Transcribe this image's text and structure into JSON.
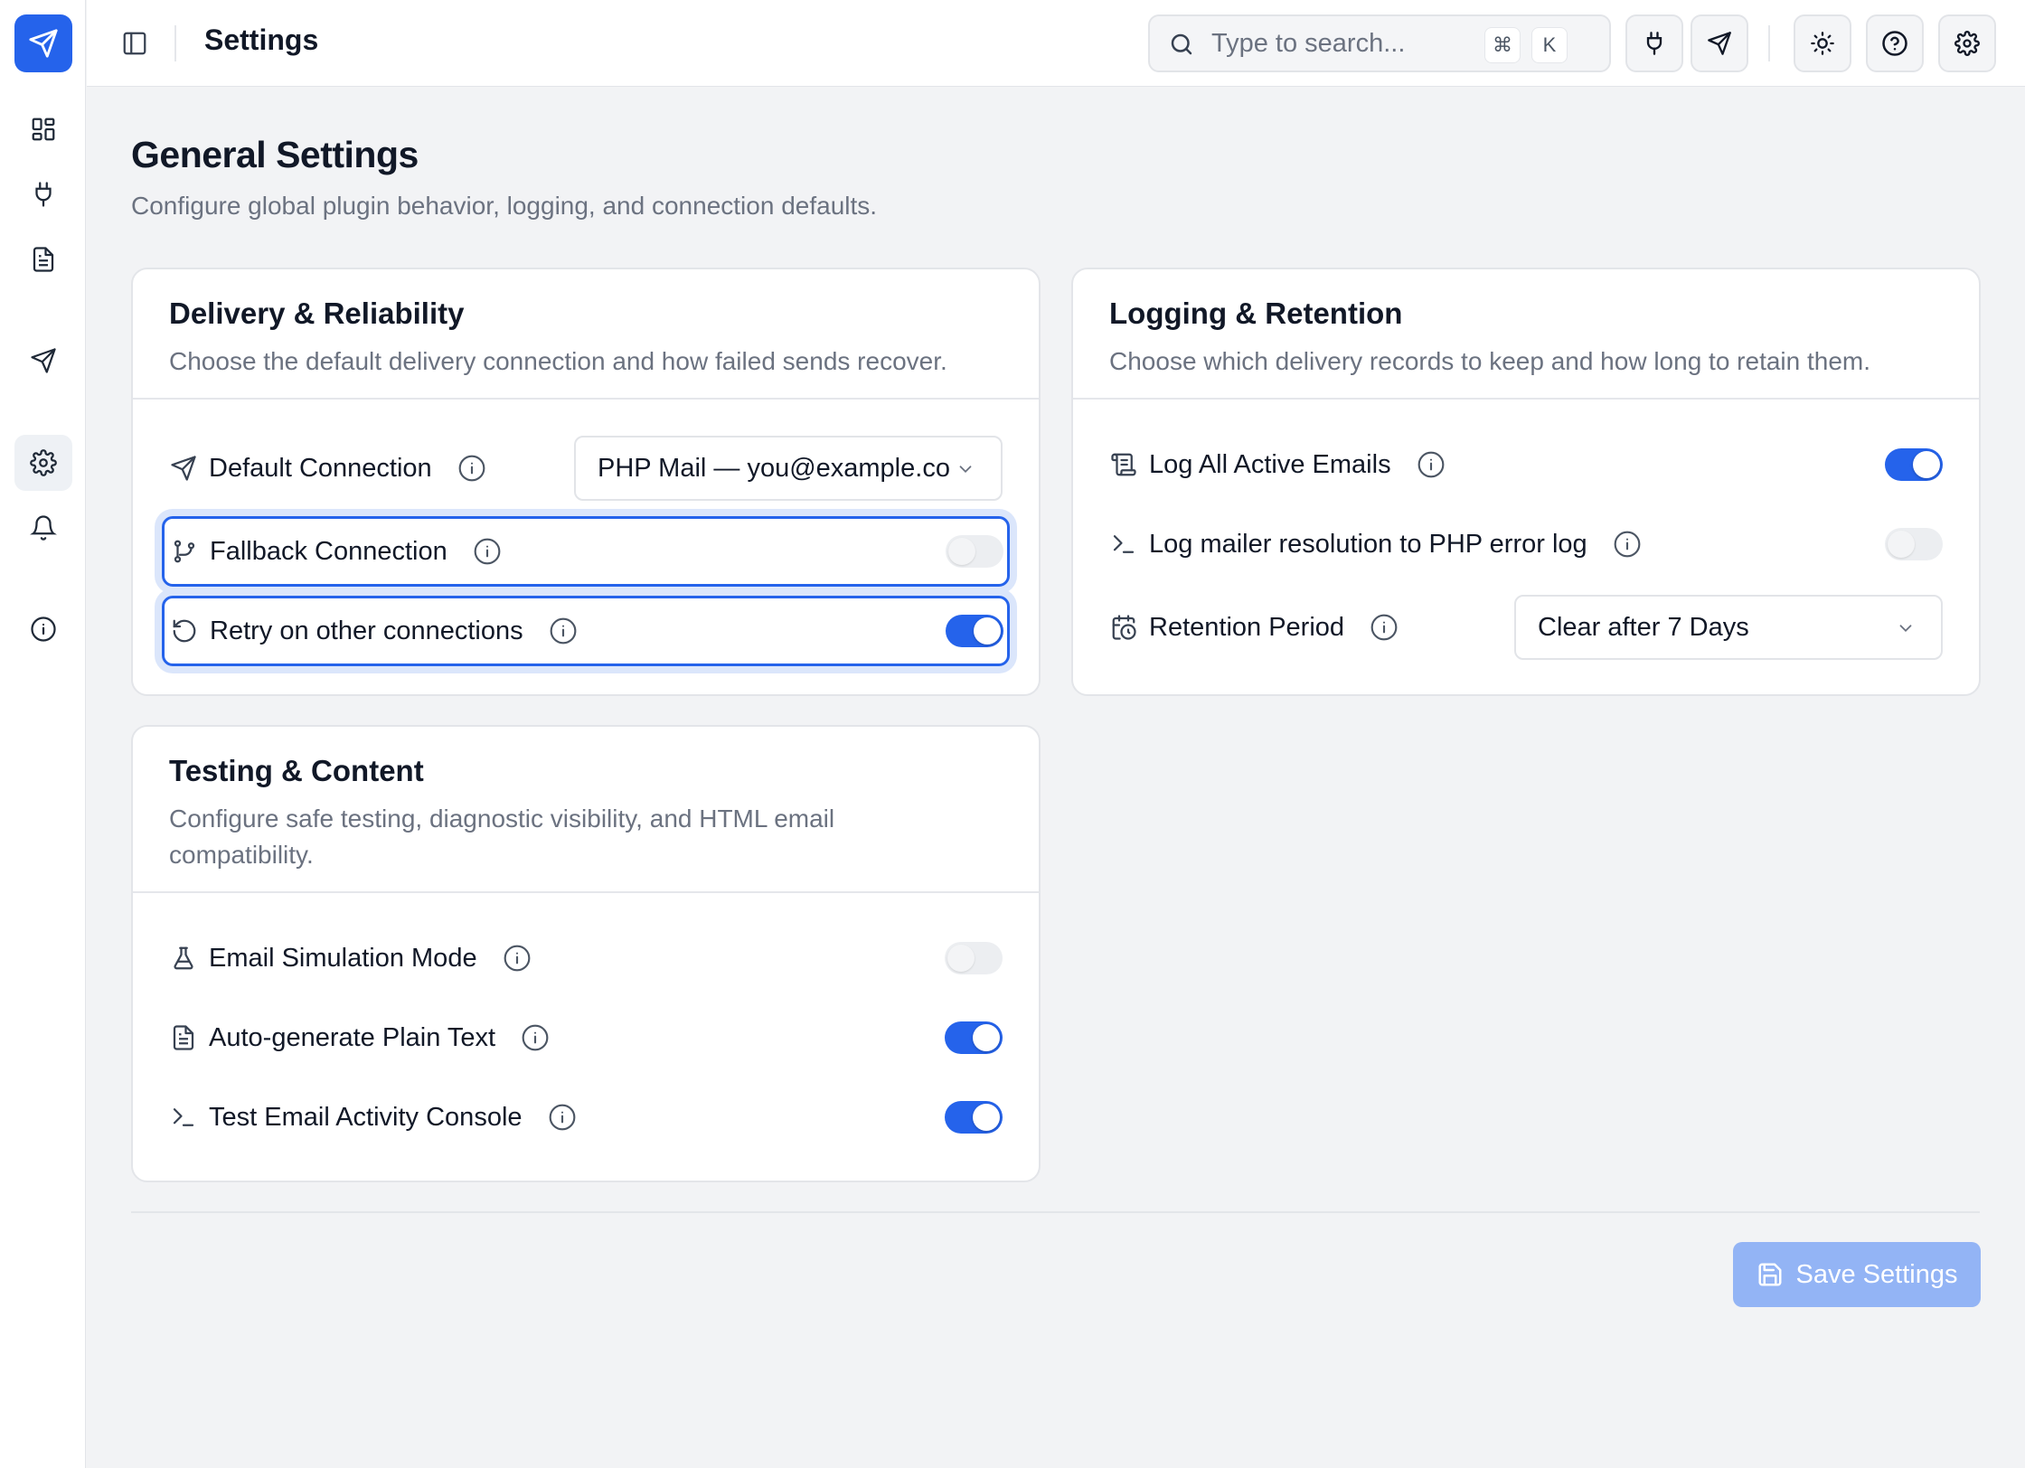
{
  "colors": {
    "accent": "#2563eb",
    "save_disabled": "#93b4f5"
  },
  "sidebar": {
    "items": [
      {
        "name": "dashboard",
        "icon": "dashboard-icon"
      },
      {
        "name": "connections",
        "icon": "plug-icon"
      },
      {
        "name": "logs",
        "icon": "document-icon"
      },
      {
        "name": "send",
        "icon": "send-icon"
      },
      {
        "name": "settings",
        "icon": "gear-icon",
        "active": true
      },
      {
        "name": "notifications",
        "icon": "bell-icon"
      },
      {
        "name": "about",
        "icon": "info-icon"
      }
    ]
  },
  "topbar": {
    "title": "Settings",
    "search": {
      "placeholder": "Type to search...",
      "shortcut_mod": "⌘",
      "shortcut_key": "K"
    }
  },
  "page": {
    "title": "General Settings",
    "subtitle": "Configure global plugin behavior, logging, and connection defaults."
  },
  "delivery": {
    "title": "Delivery & Reliability",
    "description": "Choose the default delivery connection and how failed sends recover.",
    "default_connection": {
      "label": "Default Connection",
      "value": "PHP Mail — you@example.co"
    },
    "fallback_connection": {
      "label": "Fallback Connection",
      "enabled": false
    },
    "retry_connections": {
      "label": "Retry on other connections",
      "enabled": true
    }
  },
  "logging": {
    "title": "Logging & Retention",
    "description": "Choose which delivery records to keep and how long to retain them.",
    "log_all": {
      "label": "Log All Active Emails",
      "enabled": true
    },
    "log_php": {
      "label": "Log mailer resolution to PHP error log",
      "enabled": false
    },
    "retention": {
      "label": "Retention Period",
      "value": "Clear after 7 Days"
    }
  },
  "testing": {
    "title": "Testing & Content",
    "description": "Configure safe testing, diagnostic visibility, and HTML email compatibility.",
    "simulation": {
      "label": "Email Simulation Mode",
      "enabled": false
    },
    "plain_text": {
      "label": "Auto-generate Plain Text",
      "enabled": true
    },
    "console": {
      "label": "Test Email Activity Console",
      "enabled": true
    }
  },
  "actions": {
    "save_label": "Save Settings"
  }
}
